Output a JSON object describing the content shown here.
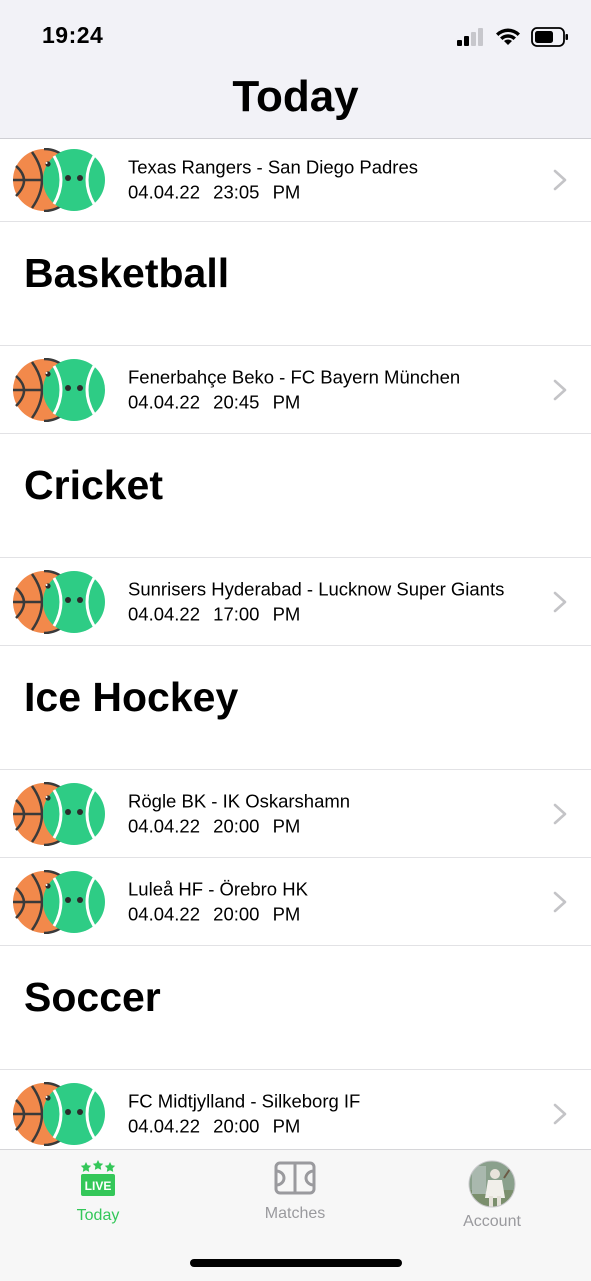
{
  "status_bar": {
    "time": "19:24"
  },
  "header": {
    "title": "Today"
  },
  "sections": [
    {
      "heading": "",
      "matches": [
        {
          "title": "Texas Rangers - San Diego Padres",
          "date": "04.04.22",
          "time": "23:05 PM"
        }
      ]
    },
    {
      "heading": "Basketball",
      "matches": [
        {
          "title": "Fenerbahçe Beko - FC Bayern München",
          "date": "04.04.22",
          "time": "20:45 PM"
        }
      ]
    },
    {
      "heading": "Cricket",
      "matches": [
        {
          "title": "Sunrisers Hyderabad - Lucknow Super Giants",
          "date": "04.04.22",
          "time": "17:00 PM"
        }
      ]
    },
    {
      "heading": "Ice Hockey",
      "matches": [
        {
          "title": "Rögle BK - IK Oskarshamn",
          "date": "04.04.22",
          "time": "20:00 PM"
        },
        {
          "title": "Luleå HF - Örebro HK",
          "date": "04.04.22",
          "time": "20:00 PM"
        }
      ]
    },
    {
      "heading": "Soccer",
      "matches": [
        {
          "title": "FC Midtjylland - Silkeborg IF",
          "date": "04.04.22",
          "time": "20:00 PM"
        }
      ]
    }
  ],
  "tab_bar": {
    "today": {
      "label": "Today",
      "badge": "LIVE",
      "icon": "live-tv-icon"
    },
    "matches": {
      "label": "Matches",
      "icon": "field-icon"
    },
    "account": {
      "label": "Account",
      "icon": "avatar"
    }
  },
  "colors": {
    "accent": "#34c759",
    "inactive": "#9a9a9e",
    "basketball": "#f2894b",
    "ball_green": "#2ecc85"
  }
}
